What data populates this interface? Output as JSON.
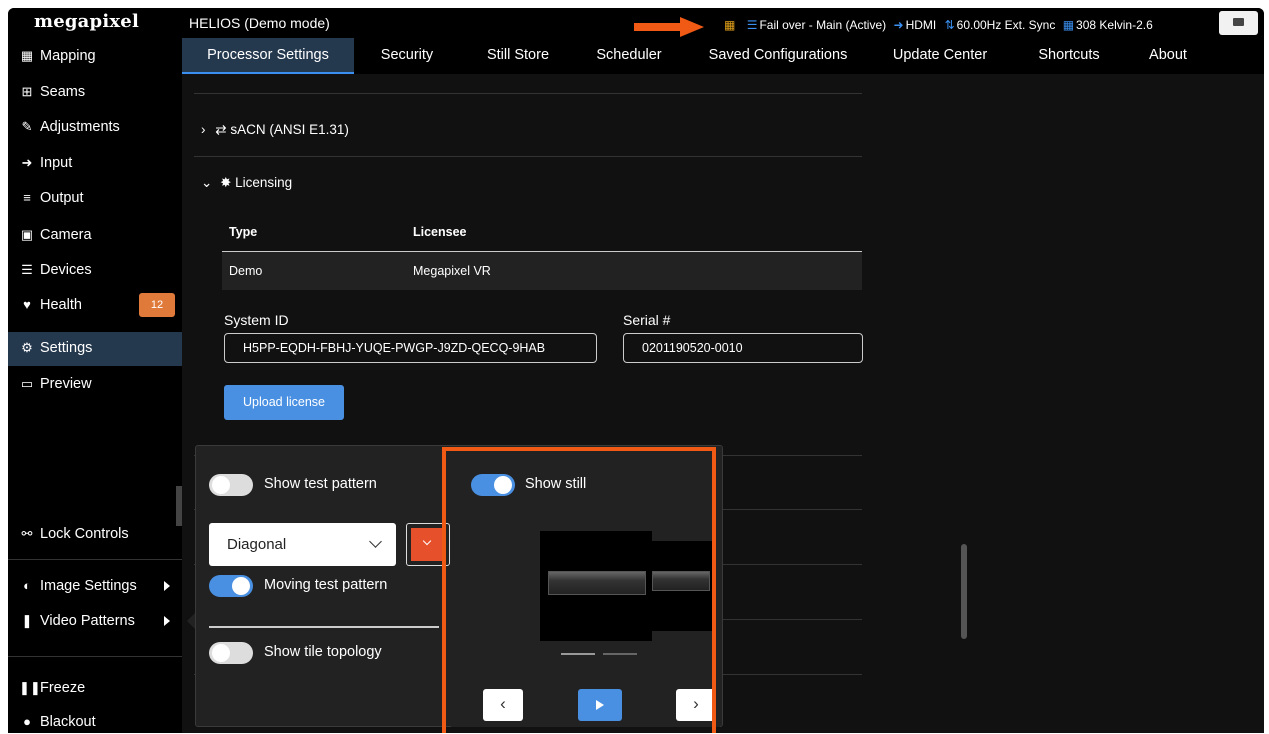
{
  "app": {
    "logo": "megapixel",
    "title": "HELIOS (Demo mode)",
    "status": {
      "failover": "Fail over - Main (Active)",
      "input": "HDMI",
      "sync": "60.00Hz Ext. Sync",
      "device": "308 Kelvin-2.6"
    },
    "accent": "#3a8ff0",
    "highlight": "#f05a14"
  },
  "tabs": [
    "Processor Settings",
    "Security",
    "Still Store",
    "Scheduler",
    "Saved Configurations",
    "Update Center",
    "Shortcuts",
    "About"
  ],
  "sidebar": {
    "items": [
      {
        "label": "Mapping",
        "icon": "grid-icon"
      },
      {
        "label": "Seams",
        "icon": "plus-square-icon"
      },
      {
        "label": "Adjustments",
        "icon": "brush-icon"
      },
      {
        "label": "Input",
        "icon": "sign-in-icon"
      },
      {
        "label": "Output",
        "icon": "sliders-icon"
      },
      {
        "label": "Camera",
        "icon": "film-icon"
      },
      {
        "label": "Devices",
        "icon": "list-icon"
      },
      {
        "label": "Health",
        "icon": "heartbeat-icon",
        "badge": "12"
      },
      {
        "label": "Settings",
        "icon": "cogs-icon"
      },
      {
        "label": "Preview",
        "icon": "monitor-icon"
      }
    ],
    "lock": "Lock Controls",
    "image_settings": "Image Settings",
    "video_patterns": "Video Patterns",
    "freeze": "Freeze",
    "blackout": "Blackout"
  },
  "main": {
    "sacn": "sACN (ANSI E1.31)",
    "licensing": "Licensing",
    "table": {
      "headers": [
        "Type",
        "Licensee"
      ],
      "row": [
        "Demo",
        "Megapixel VR"
      ]
    },
    "system_id_label": "System ID",
    "system_id": "H5PP-EQDH-FBHJ-YUQE-PWGP-J9ZD-QECQ-9HAB",
    "serial_label": "Serial #",
    "serial": "0201190520-0010",
    "upload": "Upload license"
  },
  "popover": {
    "show_test_pattern": "Show test pattern",
    "pattern": "Diagonal",
    "moving": "Moving test pattern",
    "tile_topology": "Show tile topology",
    "show_still": "Show still",
    "pattern_color": "#e6502a"
  }
}
